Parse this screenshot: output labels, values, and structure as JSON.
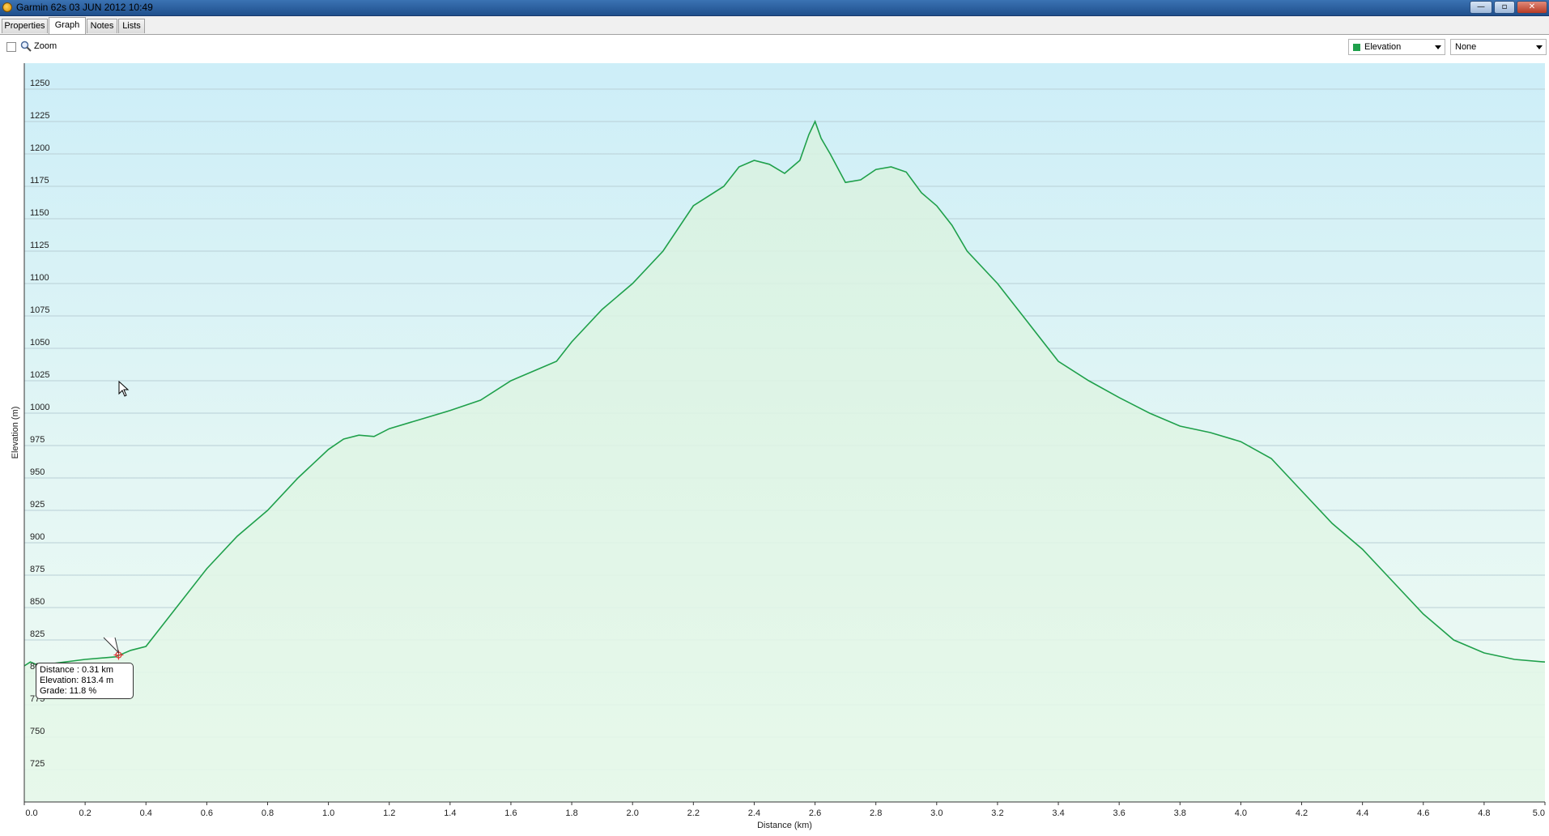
{
  "window": {
    "title": "Garmin 62s 03 JUN 2012 10:49",
    "minimize_glyph": "—",
    "restore_glyph": "▫",
    "close_glyph": "✕"
  },
  "tabs": [
    {
      "label": "Properties",
      "active": false
    },
    {
      "label": "Graph",
      "active": true
    },
    {
      "label": "Notes",
      "active": false
    },
    {
      "label": "Lists",
      "active": false
    }
  ],
  "toolbar": {
    "zoom_label": "Zoom",
    "zoom_checked": false,
    "series1": {
      "label": "Elevation",
      "color": "#1fa04b"
    },
    "series2": {
      "label": "None"
    }
  },
  "tooltip": {
    "distance": "Distance : 0.31 km",
    "elevation": "Elevation: 813.4 m",
    "grade": "Grade: 11.8 %"
  },
  "chart_data": {
    "type": "area",
    "xlabel": "Distance  (km)",
    "ylabel": "Elevation (m)",
    "xlim": [
      0.0,
      5.0
    ],
    "ylim": [
      700,
      1270
    ],
    "x_ticks": [
      0.0,
      0.2,
      0.4,
      0.6,
      0.8,
      1.0,
      1.2,
      1.4,
      1.6,
      1.8,
      2.0,
      2.2,
      2.4,
      2.6,
      2.8,
      3.0,
      3.2,
      3.4,
      3.6,
      3.8,
      4.0,
      4.2,
      4.4,
      4.6,
      4.8,
      5.0
    ],
    "x_tick_labels": [
      "0.0",
      "0.2",
      "0.4",
      "0.6",
      "0.8",
      "1.0",
      "1.2",
      "1.4",
      "1.6",
      "1.8",
      "2.0",
      "2.2",
      "2.4",
      "2.6",
      "2.8",
      "3.0",
      "3.2",
      "3.4",
      "3.6",
      "3.8",
      "4.0",
      "4.2",
      "4.4",
      "4.6",
      "4.8",
      "5.0"
    ],
    "y_ticks": [
      725,
      750,
      775,
      800,
      825,
      850,
      875,
      900,
      925,
      950,
      975,
      1000,
      1025,
      1050,
      1075,
      1100,
      1125,
      1150,
      1175,
      1200,
      1225,
      1250
    ],
    "y_tick_labels": [
      "725",
      "750",
      "775",
      "800",
      "825",
      "850",
      "875",
      "900",
      "925",
      "950",
      "975",
      "1000",
      "1025",
      "1050",
      "1075",
      "1100",
      "1125",
      "1150",
      "1175",
      "1200",
      "1225",
      "1250"
    ],
    "grid": true,
    "series": [
      {
        "name": "Elevation",
        "color": "#1fa04b",
        "x": [
          0.0,
          0.02,
          0.05,
          0.1,
          0.2,
          0.3,
          0.31,
          0.35,
          0.4,
          0.45,
          0.5,
          0.6,
          0.7,
          0.8,
          0.9,
          1.0,
          1.05,
          1.1,
          1.15,
          1.2,
          1.3,
          1.4,
          1.5,
          1.6,
          1.7,
          1.75,
          1.8,
          1.9,
          2.0,
          2.1,
          2.2,
          2.3,
          2.35,
          2.4,
          2.45,
          2.5,
          2.55,
          2.58,
          2.6,
          2.62,
          2.65,
          2.7,
          2.75,
          2.8,
          2.85,
          2.9,
          2.95,
          3.0,
          3.05,
          3.1,
          3.2,
          3.3,
          3.4,
          3.5,
          3.6,
          3.7,
          3.8,
          3.9,
          4.0,
          4.1,
          4.2,
          4.3,
          4.4,
          4.5,
          4.6,
          4.7,
          4.8,
          4.9,
          5.0
        ],
        "y": [
          805,
          808,
          805,
          807,
          810,
          812,
          813,
          817,
          820,
          835,
          850,
          880,
          905,
          925,
          950,
          972,
          980,
          983,
          982,
          988,
          995,
          1002,
          1010,
          1025,
          1035,
          1040,
          1055,
          1080,
          1100,
          1125,
          1160,
          1175,
          1190,
          1195,
          1192,
          1185,
          1195,
          1215,
          1225,
          1212,
          1200,
          1178,
          1180,
          1188,
          1190,
          1186,
          1170,
          1160,
          1145,
          1125,
          1100,
          1070,
          1040,
          1025,
          1012,
          1000,
          990,
          985,
          978,
          965,
          940,
          915,
          895,
          870,
          845,
          825,
          815,
          810,
          808
        ]
      }
    ]
  }
}
